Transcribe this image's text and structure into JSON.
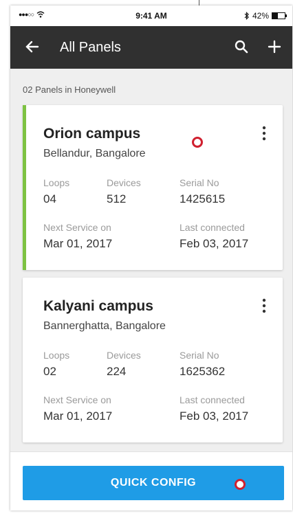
{
  "status_bar": {
    "signal": "●●●○○",
    "time": "9:41 AM",
    "battery": "42%",
    "battery_level": 0.42
  },
  "app_bar": {
    "title": "All Panels"
  },
  "panel_count_text": "02 Panels in Honeywell",
  "labels": {
    "loops": "Loops",
    "devices": "Devices",
    "serial": "Serial No",
    "next_service": "Next Service on",
    "last_connected": "Last connected"
  },
  "panels": [
    {
      "name": "Orion campus",
      "location": "Bellandur, Bangalore",
      "loops": "04",
      "devices": "512",
      "serial": "1425615",
      "next_service": "Mar 01, 2017",
      "last_connected": "Feb 03, 2017"
    },
    {
      "name": "Kalyani campus",
      "location": "Bannerghatta, Bangalore",
      "loops": "02",
      "devices": "224",
      "serial": "1625362",
      "next_service": "Mar 01, 2017",
      "last_connected": "Feb 03, 2017"
    }
  ],
  "quick_config_label": "QUICK CONFIG",
  "colors": {
    "app_bar": "#303030",
    "accent_green": "#7dc242",
    "button_blue": "#1f9ce6",
    "marker_red": "#d0202f"
  },
  "icons": {
    "back": "arrow-left-icon",
    "search": "search-icon",
    "add": "plus-icon",
    "more": "more-vertical-icon"
  }
}
